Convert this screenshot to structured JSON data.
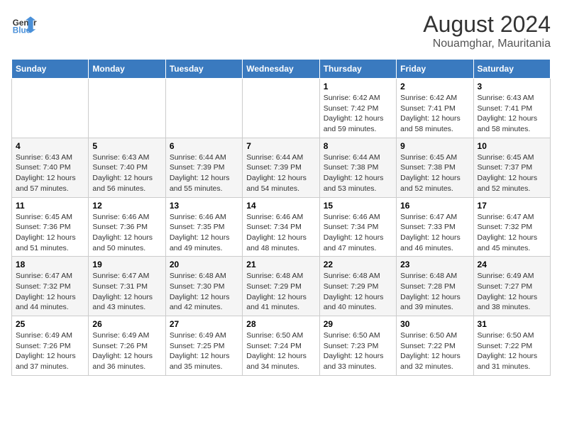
{
  "header": {
    "logo_line1": "General",
    "logo_line2": "Blue",
    "month_year": "August 2024",
    "location": "Nouamghar, Mauritania"
  },
  "weekdays": [
    "Sunday",
    "Monday",
    "Tuesday",
    "Wednesday",
    "Thursday",
    "Friday",
    "Saturday"
  ],
  "weeks": [
    [
      {
        "day": "",
        "info": ""
      },
      {
        "day": "",
        "info": ""
      },
      {
        "day": "",
        "info": ""
      },
      {
        "day": "",
        "info": ""
      },
      {
        "day": "1",
        "info": "Sunrise: 6:42 AM\nSunset: 7:42 PM\nDaylight: 12 hours\nand 59 minutes."
      },
      {
        "day": "2",
        "info": "Sunrise: 6:42 AM\nSunset: 7:41 PM\nDaylight: 12 hours\nand 58 minutes."
      },
      {
        "day": "3",
        "info": "Sunrise: 6:43 AM\nSunset: 7:41 PM\nDaylight: 12 hours\nand 58 minutes."
      }
    ],
    [
      {
        "day": "4",
        "info": "Sunrise: 6:43 AM\nSunset: 7:40 PM\nDaylight: 12 hours\nand 57 minutes."
      },
      {
        "day": "5",
        "info": "Sunrise: 6:43 AM\nSunset: 7:40 PM\nDaylight: 12 hours\nand 56 minutes."
      },
      {
        "day": "6",
        "info": "Sunrise: 6:44 AM\nSunset: 7:39 PM\nDaylight: 12 hours\nand 55 minutes."
      },
      {
        "day": "7",
        "info": "Sunrise: 6:44 AM\nSunset: 7:39 PM\nDaylight: 12 hours\nand 54 minutes."
      },
      {
        "day": "8",
        "info": "Sunrise: 6:44 AM\nSunset: 7:38 PM\nDaylight: 12 hours\nand 53 minutes."
      },
      {
        "day": "9",
        "info": "Sunrise: 6:45 AM\nSunset: 7:38 PM\nDaylight: 12 hours\nand 52 minutes."
      },
      {
        "day": "10",
        "info": "Sunrise: 6:45 AM\nSunset: 7:37 PM\nDaylight: 12 hours\nand 52 minutes."
      }
    ],
    [
      {
        "day": "11",
        "info": "Sunrise: 6:45 AM\nSunset: 7:36 PM\nDaylight: 12 hours\nand 51 minutes."
      },
      {
        "day": "12",
        "info": "Sunrise: 6:46 AM\nSunset: 7:36 PM\nDaylight: 12 hours\nand 50 minutes."
      },
      {
        "day": "13",
        "info": "Sunrise: 6:46 AM\nSunset: 7:35 PM\nDaylight: 12 hours\nand 49 minutes."
      },
      {
        "day": "14",
        "info": "Sunrise: 6:46 AM\nSunset: 7:34 PM\nDaylight: 12 hours\nand 48 minutes."
      },
      {
        "day": "15",
        "info": "Sunrise: 6:46 AM\nSunset: 7:34 PM\nDaylight: 12 hours\nand 47 minutes."
      },
      {
        "day": "16",
        "info": "Sunrise: 6:47 AM\nSunset: 7:33 PM\nDaylight: 12 hours\nand 46 minutes."
      },
      {
        "day": "17",
        "info": "Sunrise: 6:47 AM\nSunset: 7:32 PM\nDaylight: 12 hours\nand 45 minutes."
      }
    ],
    [
      {
        "day": "18",
        "info": "Sunrise: 6:47 AM\nSunset: 7:32 PM\nDaylight: 12 hours\nand 44 minutes."
      },
      {
        "day": "19",
        "info": "Sunrise: 6:47 AM\nSunset: 7:31 PM\nDaylight: 12 hours\nand 43 minutes."
      },
      {
        "day": "20",
        "info": "Sunrise: 6:48 AM\nSunset: 7:30 PM\nDaylight: 12 hours\nand 42 minutes."
      },
      {
        "day": "21",
        "info": "Sunrise: 6:48 AM\nSunset: 7:29 PM\nDaylight: 12 hours\nand 41 minutes."
      },
      {
        "day": "22",
        "info": "Sunrise: 6:48 AM\nSunset: 7:29 PM\nDaylight: 12 hours\nand 40 minutes."
      },
      {
        "day": "23",
        "info": "Sunrise: 6:48 AM\nSunset: 7:28 PM\nDaylight: 12 hours\nand 39 minutes."
      },
      {
        "day": "24",
        "info": "Sunrise: 6:49 AM\nSunset: 7:27 PM\nDaylight: 12 hours\nand 38 minutes."
      }
    ],
    [
      {
        "day": "25",
        "info": "Sunrise: 6:49 AM\nSunset: 7:26 PM\nDaylight: 12 hours\nand 37 minutes."
      },
      {
        "day": "26",
        "info": "Sunrise: 6:49 AM\nSunset: 7:26 PM\nDaylight: 12 hours\nand 36 minutes."
      },
      {
        "day": "27",
        "info": "Sunrise: 6:49 AM\nSunset: 7:25 PM\nDaylight: 12 hours\nand 35 minutes."
      },
      {
        "day": "28",
        "info": "Sunrise: 6:50 AM\nSunset: 7:24 PM\nDaylight: 12 hours\nand 34 minutes."
      },
      {
        "day": "29",
        "info": "Sunrise: 6:50 AM\nSunset: 7:23 PM\nDaylight: 12 hours\nand 33 minutes."
      },
      {
        "day": "30",
        "info": "Sunrise: 6:50 AM\nSunset: 7:22 PM\nDaylight: 12 hours\nand 32 minutes."
      },
      {
        "day": "31",
        "info": "Sunrise: 6:50 AM\nSunset: 7:22 PM\nDaylight: 12 hours\nand 31 minutes."
      }
    ]
  ]
}
